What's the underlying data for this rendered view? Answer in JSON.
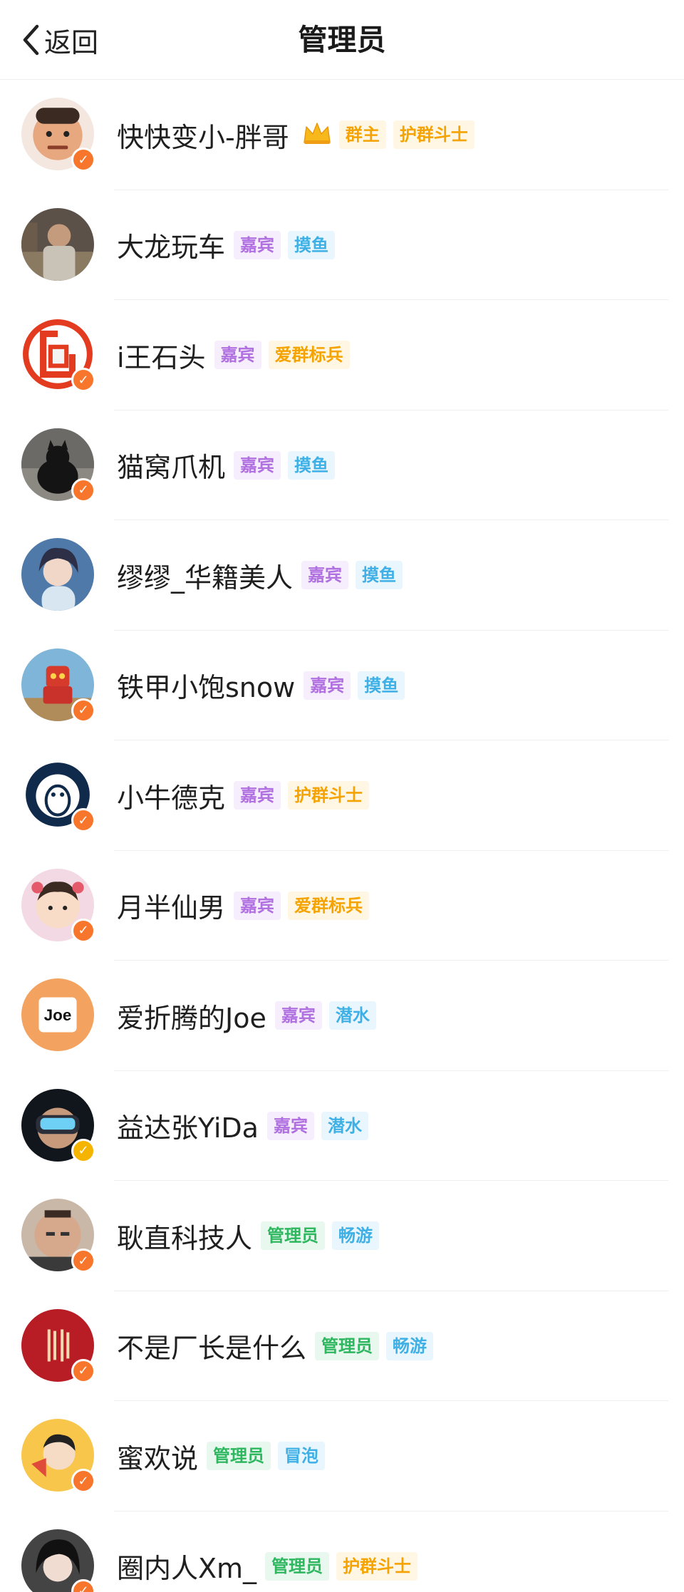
{
  "nav": {
    "back_label": "返回",
    "title": "管理员"
  },
  "members": [
    {
      "name": "快快变小-胖哥",
      "crown": true,
      "badge": "orange",
      "avatar": "cartoon-man",
      "tags": [
        {
          "label": "群主",
          "color": "orange"
        },
        {
          "label": "护群斗士",
          "color": "orange"
        }
      ]
    },
    {
      "name": "大龙玩车",
      "badge": "none",
      "avatar": "photo-man-car",
      "tags": [
        {
          "label": "嘉宾",
          "color": "purple"
        },
        {
          "label": "摸鱼",
          "color": "blue"
        }
      ]
    },
    {
      "name": "i王石头",
      "badge": "orange",
      "avatar": "red-logo",
      "tags": [
        {
          "label": "嘉宾",
          "color": "purple"
        },
        {
          "label": "爱群标兵",
          "color": "orange"
        }
      ]
    },
    {
      "name": "猫窝爪机",
      "badge": "orange",
      "avatar": "black-cat",
      "tags": [
        {
          "label": "嘉宾",
          "color": "purple"
        },
        {
          "label": "摸鱼",
          "color": "blue"
        }
      ]
    },
    {
      "name": "缪缪_华籍美人",
      "badge": "none",
      "avatar": "woman-portrait",
      "tags": [
        {
          "label": "嘉宾",
          "color": "purple"
        },
        {
          "label": "摸鱼",
          "color": "blue"
        }
      ]
    },
    {
      "name": "铁甲小饱snow",
      "badge": "orange",
      "avatar": "robot-toy",
      "tags": [
        {
          "label": "嘉宾",
          "color": "purple"
        },
        {
          "label": "摸鱼",
          "color": "blue"
        }
      ]
    },
    {
      "name": "小牛德克",
      "badge": "orange",
      "avatar": "horse-logo",
      "tags": [
        {
          "label": "嘉宾",
          "color": "purple"
        },
        {
          "label": "护群斗士",
          "color": "orange"
        }
      ]
    },
    {
      "name": "月半仙男",
      "badge": "orange",
      "avatar": "cartoon-kid",
      "tags": [
        {
          "label": "嘉宾",
          "color": "purple"
        },
        {
          "label": "爱群标兵",
          "color": "orange"
        }
      ]
    },
    {
      "name": "爱折腾的Joe",
      "badge": "none",
      "avatar": "joe-logo",
      "avatar_text": "Joe",
      "tags": [
        {
          "label": "嘉宾",
          "color": "purple"
        },
        {
          "label": "潜水",
          "color": "blue"
        }
      ]
    },
    {
      "name": "益达张YiDa",
      "badge": "gold",
      "avatar": "vr-headset",
      "tags": [
        {
          "label": "嘉宾",
          "color": "purple"
        },
        {
          "label": "潜水",
          "color": "blue"
        }
      ]
    },
    {
      "name": "耿直科技人",
      "badge": "orange",
      "avatar": "man-selfie",
      "tags": [
        {
          "label": "管理员",
          "color": "green"
        },
        {
          "label": "畅游",
          "color": "blue"
        }
      ]
    },
    {
      "name": "不是厂长是什么",
      "badge": "orange",
      "avatar": "red-calligraphy",
      "tags": [
        {
          "label": "管理员",
          "color": "green"
        },
        {
          "label": "畅游",
          "color": "blue"
        }
      ]
    },
    {
      "name": "蜜欢说",
      "badge": "orange",
      "avatar": "cartoon-megaphone",
      "tags": [
        {
          "label": "管理员",
          "color": "green"
        },
        {
          "label": "冒泡",
          "color": "blue"
        }
      ]
    },
    {
      "name": "圈内人Xm_",
      "badge": "orange",
      "avatar": "woman-dark-hair",
      "tags": [
        {
          "label": "管理员",
          "color": "green"
        },
        {
          "label": "护群斗士",
          "color": "orange"
        }
      ]
    }
  ],
  "colors": {
    "tag_purple": "#b070e0",
    "tag_blue": "#3fb0e6",
    "tag_orange": "#f5a300",
    "tag_green": "#2fb760",
    "badge_orange": "#f7762c",
    "badge_gold": "#f5b400"
  }
}
